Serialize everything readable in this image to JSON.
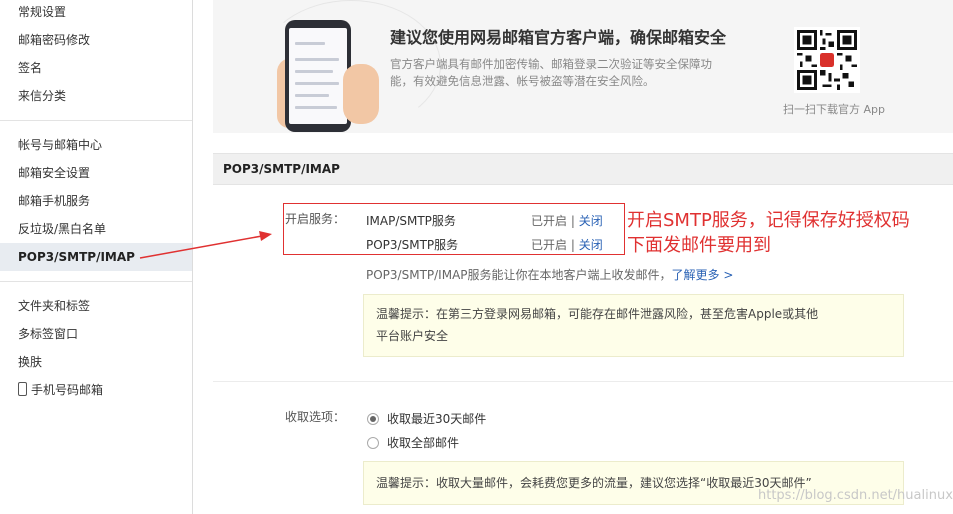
{
  "sidebar": {
    "group1": [
      "常规设置",
      "邮箱密码修改",
      "签名",
      "来信分类"
    ],
    "group2": [
      "帐号与邮箱中心",
      "邮箱安全设置",
      "邮箱手机服务",
      "反垃圾/黑白名单",
      "POP3/SMTP/IMAP"
    ],
    "group3": [
      "文件夹和标签",
      "多标签窗口",
      "换肤",
      "手机号码邮箱"
    ]
  },
  "banner": {
    "title": "建议您使用网易邮箱官方客户端，确保邮箱安全",
    "desc": "官方客户端具有邮件加密传输、邮箱登录二次验证等安全保障功能，有效避免信息泄露、帐号被盗等潜在安全风险。",
    "qr_caption": "扫一扫下载官方 App"
  },
  "section": {
    "title": "POP3/SMTP/IMAP",
    "services_label": "开启服务：",
    "services": [
      {
        "name": "IMAP/SMTP服务",
        "status": "已开启",
        "sep": " | ",
        "action": "关闭"
      },
      {
        "name": "POP3/SMTP服务",
        "status": "已开启",
        "sep": " | ",
        "action": "关闭"
      }
    ],
    "info_text": "POP3/SMTP/IMAP服务能让你在本地客户端上收发邮件，",
    "info_link": "了解更多 >",
    "tip1_line1": "温馨提示：在第三方登录网易邮箱，可能存在邮件泄露风险，甚至危害Apple或其他",
    "tip1_line2": "平台账户安全",
    "receive_label": "收取选项：",
    "receive_options": [
      {
        "label": "收取最近30天邮件",
        "checked": true
      },
      {
        "label": "收取全部邮件",
        "checked": false
      }
    ],
    "tip2": "温馨提示：收取大量邮件，会耗费您更多的流量，建议您选择“收取最近30天邮件”"
  },
  "annotation": {
    "line1": "开启SMTP服务，记得保存好授权码",
    "line2": "下面发邮件要用到",
    "color": "#e03131"
  },
  "watermark": "https://blog.csdn.net/hualinux"
}
